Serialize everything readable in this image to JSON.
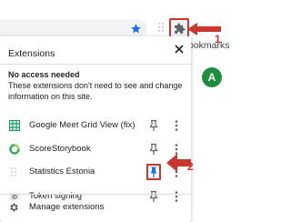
{
  "browser": {
    "bookmarks_text": "ookmarks",
    "avatar_letter": "A",
    "accent_color": "#1a73e8",
    "avatar_color": "#1e8e3e"
  },
  "popup": {
    "title": "Extensions",
    "section_heading": "No access needed",
    "section_description": "These extensions don't need to see and change information on this site.",
    "extensions": [
      {
        "name": "Google Meet Grid View (fix)",
        "icon": "grid-icon",
        "pinned": false
      },
      {
        "name": "ScoreStorybook",
        "icon": "circle-icon",
        "pinned": false
      },
      {
        "name": "Statistics Estonia",
        "icon": "dots-icon",
        "pinned": true
      },
      {
        "name": "Token signing",
        "icon": "id-icon",
        "pinned": false
      }
    ],
    "manage_label": "Manage extensions"
  },
  "annotations": {
    "label_1": "1",
    "label_2": "2",
    "color": "#c7372f"
  }
}
